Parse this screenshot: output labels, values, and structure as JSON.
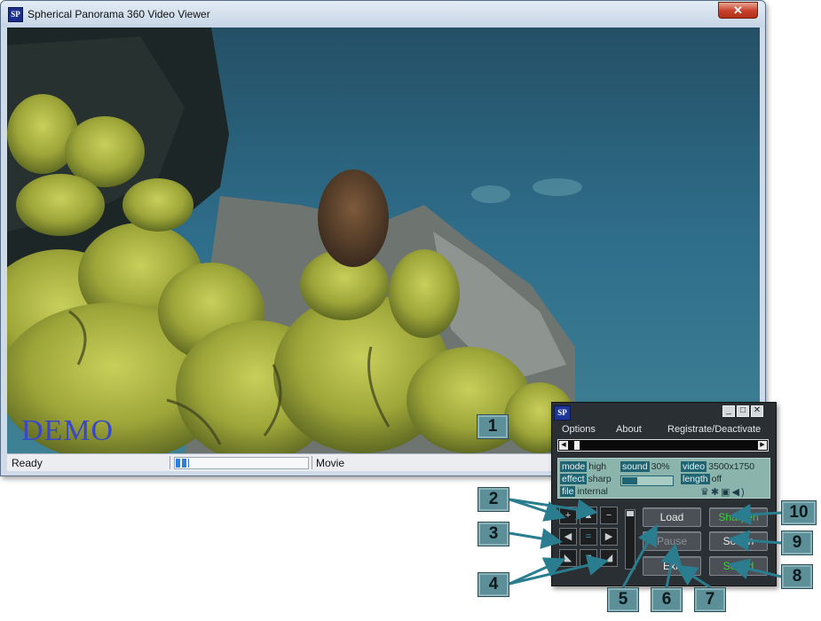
{
  "window": {
    "title": "Spherical Panorama 360 Video Viewer",
    "app_icon": "SP",
    "close_glyph": "✕"
  },
  "viewport": {
    "watermark": "DEMO"
  },
  "statusbar": {
    "status": "Ready",
    "progress_fraction": 0.1,
    "mode": "Movie"
  },
  "panel": {
    "logo": "SP",
    "window_buttons": [
      "_",
      "□",
      "✕"
    ],
    "menu": [
      "Options",
      "About",
      "Registrate/Deactivate"
    ],
    "seek_fraction": 0.03,
    "info": {
      "mode_label": "mode",
      "mode_value": "high",
      "sound_label": "sound",
      "sound_value": "30%",
      "video_label": "video",
      "video_value": "3500x1750",
      "effect_label": "effect",
      "effect_value": "sharp",
      "length_label": "length",
      "length_value": "off",
      "file_label": "file",
      "file_value": "internal",
      "sound_level": 0.3
    },
    "icons": [
      "trophy-icon",
      "gear-icon",
      "screens-icon",
      "speaker-icon"
    ],
    "nav_glyphs": {
      "zoom_in": "+",
      "up": "▲",
      "zoom_out": "−",
      "left": "◀",
      "center": "=",
      "right": "▶",
      "rotate_left": "◣",
      "down": "▼",
      "rotate_right": "◢"
    },
    "buttons": {
      "load": "Load",
      "pause": "Pause",
      "exit": "Exit",
      "sharpen": "Sharpen",
      "soften": "Soften",
      "sound": "Sound"
    }
  },
  "callouts": [
    "1",
    "2",
    "3",
    "4",
    "5",
    "6",
    "7",
    "8",
    "9",
    "10"
  ],
  "colors": {
    "callout_bg": "#5c8f98",
    "arrow": "#2a7d8f",
    "panel_bg": "#2a2f33",
    "info_bg": "#8ab4ac",
    "green_label": "#39d239"
  }
}
